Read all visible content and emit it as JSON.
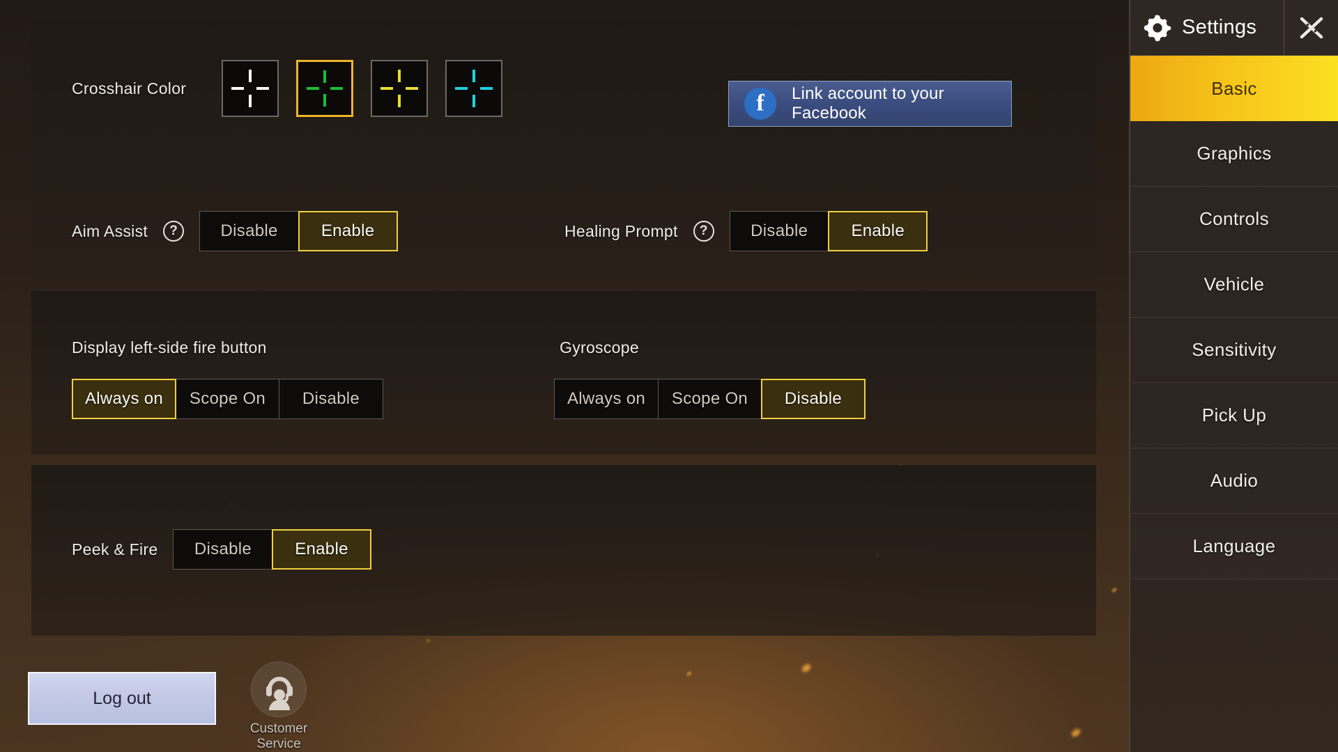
{
  "sidebar": {
    "title": "Settings",
    "gear_icon": "gear-icon",
    "close_icon": "close-x-icon",
    "tabs": [
      {
        "label": "Basic",
        "active": true
      },
      {
        "label": "Graphics",
        "active": false
      },
      {
        "label": "Controls",
        "active": false
      },
      {
        "label": "Vehicle",
        "active": false
      },
      {
        "label": "Sensitivity",
        "active": false
      },
      {
        "label": "Pick Up",
        "active": false
      },
      {
        "label": "Audio",
        "active": false
      },
      {
        "label": "Language",
        "active": false
      }
    ],
    "active_tab": "Basic",
    "active_tab_color": "#f6c31a"
  },
  "panel1": {
    "crosshair": {
      "label": "Crosshair Color",
      "selected_index": 1,
      "swatches": [
        {
          "name": "crosshair-white",
          "color": "#ffffff",
          "selected": false
        },
        {
          "name": "crosshair-green",
          "color": "#22bb33",
          "selected": true
        },
        {
          "name": "crosshair-yellow",
          "color": "#e8dd33",
          "selected": false
        },
        {
          "name": "crosshair-cyan",
          "color": "#22cfdd",
          "selected": false
        }
      ]
    },
    "facebook": {
      "label": "Link account to your Facebook",
      "icon": "facebook-icon",
      "color": "#3b4d7e"
    },
    "aim_assist": {
      "label": "Aim Assist",
      "help_icon": "question-mark-icon",
      "options": [
        "Disable",
        "Enable"
      ],
      "selected": "Enable"
    },
    "healing_prompt": {
      "label": "Healing Prompt",
      "help_icon": "question-mark-icon",
      "options": [
        "Disable",
        "Enable"
      ],
      "selected": "Enable"
    }
  },
  "panel2": {
    "fire_button": {
      "label": "Display left-side fire button",
      "options": [
        "Always on",
        "Scope On",
        "Disable"
      ],
      "selected": "Always on"
    },
    "gyroscope": {
      "label": "Gyroscope",
      "options": [
        "Always on",
        "Scope On",
        "Disable"
      ],
      "selected": "Disable"
    }
  },
  "panel3": {
    "peek_fire": {
      "label": "Peek & Fire",
      "options": [
        "Disable",
        "Enable"
      ],
      "selected": "Enable"
    }
  },
  "footer": {
    "logout_label": "Log out",
    "customer_service_label": "Customer Service",
    "customer_service_icon": "headset-support-icon"
  },
  "theme": {
    "accent": "#f0d040",
    "selected_fill": "#3a2f0f",
    "panel_bg": "#1e1915",
    "background": "#41301f"
  }
}
